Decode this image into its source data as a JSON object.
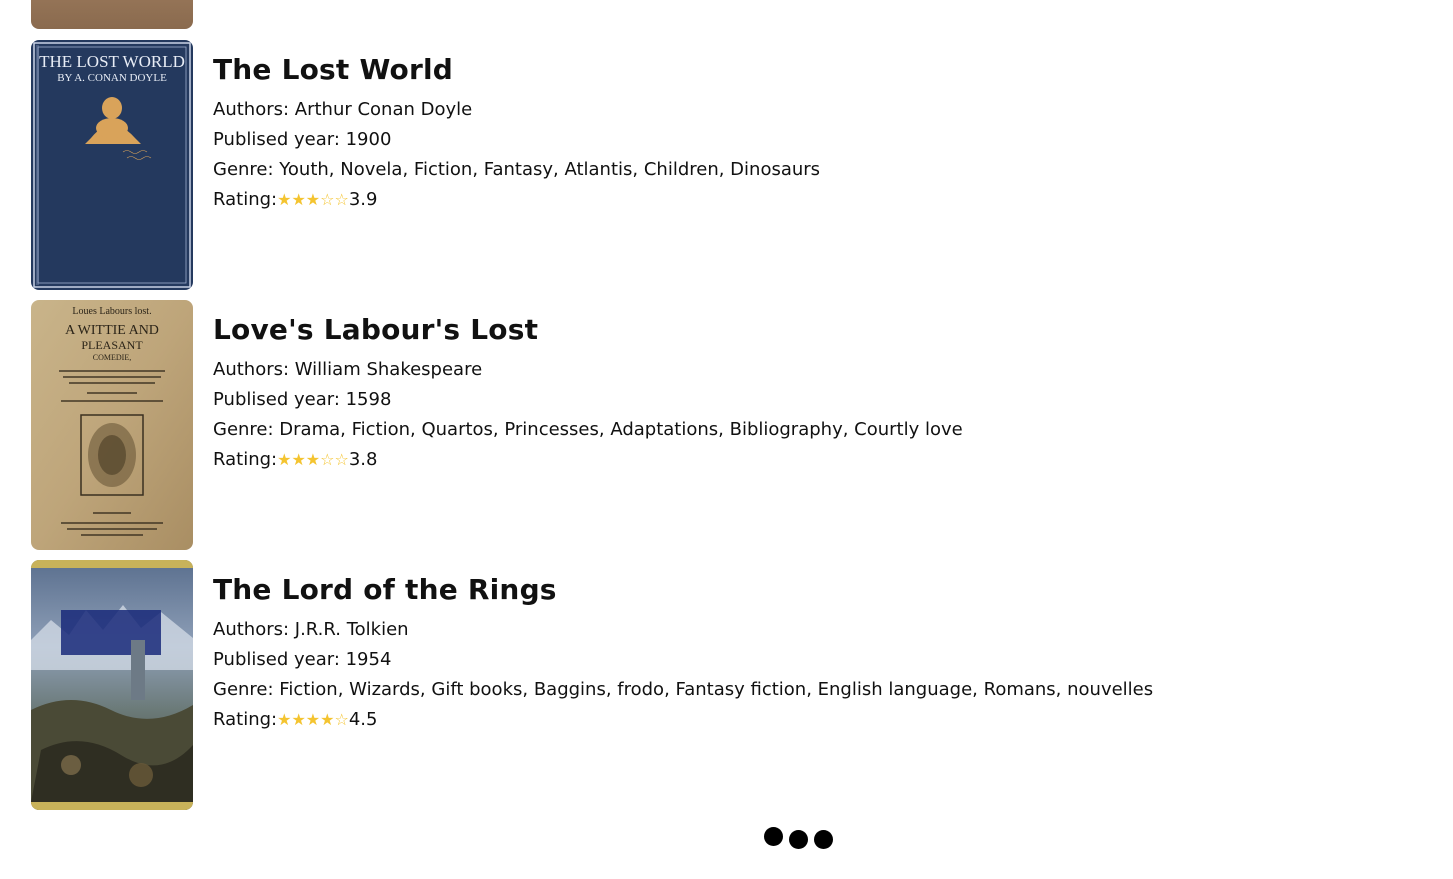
{
  "books": [
    {
      "title": "The Lost World",
      "authors_label": "Authors: Arthur Conan Doyle",
      "year_label": "Publised year: 1900",
      "genre_label": "Genre: Youth, Novela, Fiction, Fantasy, Atlantis, Children, Dinosaurs",
      "rating_prefix": "Rating:",
      "rating_stars": "★★★☆☆",
      "rating_value": "3.9",
      "cover_text": [
        "THE LOST WORLD",
        "BY A. CONAN DOYLE"
      ]
    },
    {
      "title": "Love's Labour's Lost",
      "authors_label": "Authors: William Shakespeare",
      "year_label": "Publised year: 1598",
      "genre_label": "Genre: Drama, Fiction, Quartos, Princesses, Adaptations, Bibliography, Courtly love",
      "rating_prefix": "Rating:",
      "rating_stars": "★★★☆☆",
      "rating_value": "3.8",
      "cover_text": [
        "Loues Labours lost.",
        "A WITTIE AND",
        "PLEASANT",
        "COMEDIE,"
      ]
    },
    {
      "title": "The Lord of the Rings",
      "authors_label": "Authors: J.R.R. Tolkien",
      "year_label": "Publised year: 1954",
      "genre_label": "Genre: Fiction, Wizards, Gift books, Baggins, frodo, Fantasy fiction, English language, Romans, nouvelles",
      "rating_prefix": "Rating:",
      "rating_stars": "★★★★☆",
      "rating_value": "4.5",
      "cover_text": []
    }
  ],
  "colors": {
    "star": "#f4c430",
    "text": "#111111"
  },
  "loader": {
    "icon": "loading-dots-icon"
  }
}
